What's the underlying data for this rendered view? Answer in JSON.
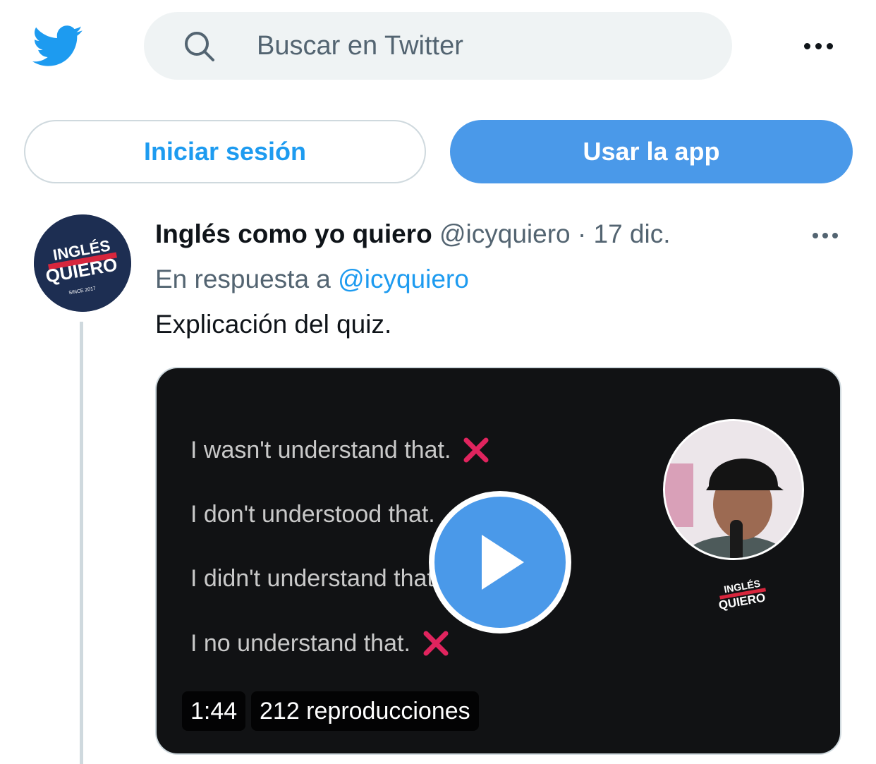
{
  "header": {
    "logo_icon": "twitter-bird-icon",
    "search_placeholder": "Buscar en Twitter",
    "more_icon": "more-horizontal-icon"
  },
  "auth": {
    "login_label": "Iniciar sesión",
    "app_label": "Usar la app"
  },
  "tweet": {
    "author_name": "Inglés como yo quiero",
    "handle": "@icyquiero",
    "separator": "·",
    "date": "17 dic.",
    "reply_prefix": "En respuesta a",
    "reply_handle": "@icyquiero",
    "text": "Explicación del quiz.",
    "avatar_logo_text": "INGLÉS COMO YO QUIERO",
    "media": {
      "lines": [
        "I wasn't understand that.",
        "I don't understood that.",
        "I didn't understand that.",
        "I no understand that."
      ],
      "duration": "1:44",
      "views": "212 reproducciones"
    }
  },
  "colors": {
    "accent": "#1d9bf0",
    "app_button": "#4a99e9",
    "x_mark": "#e0245e"
  }
}
